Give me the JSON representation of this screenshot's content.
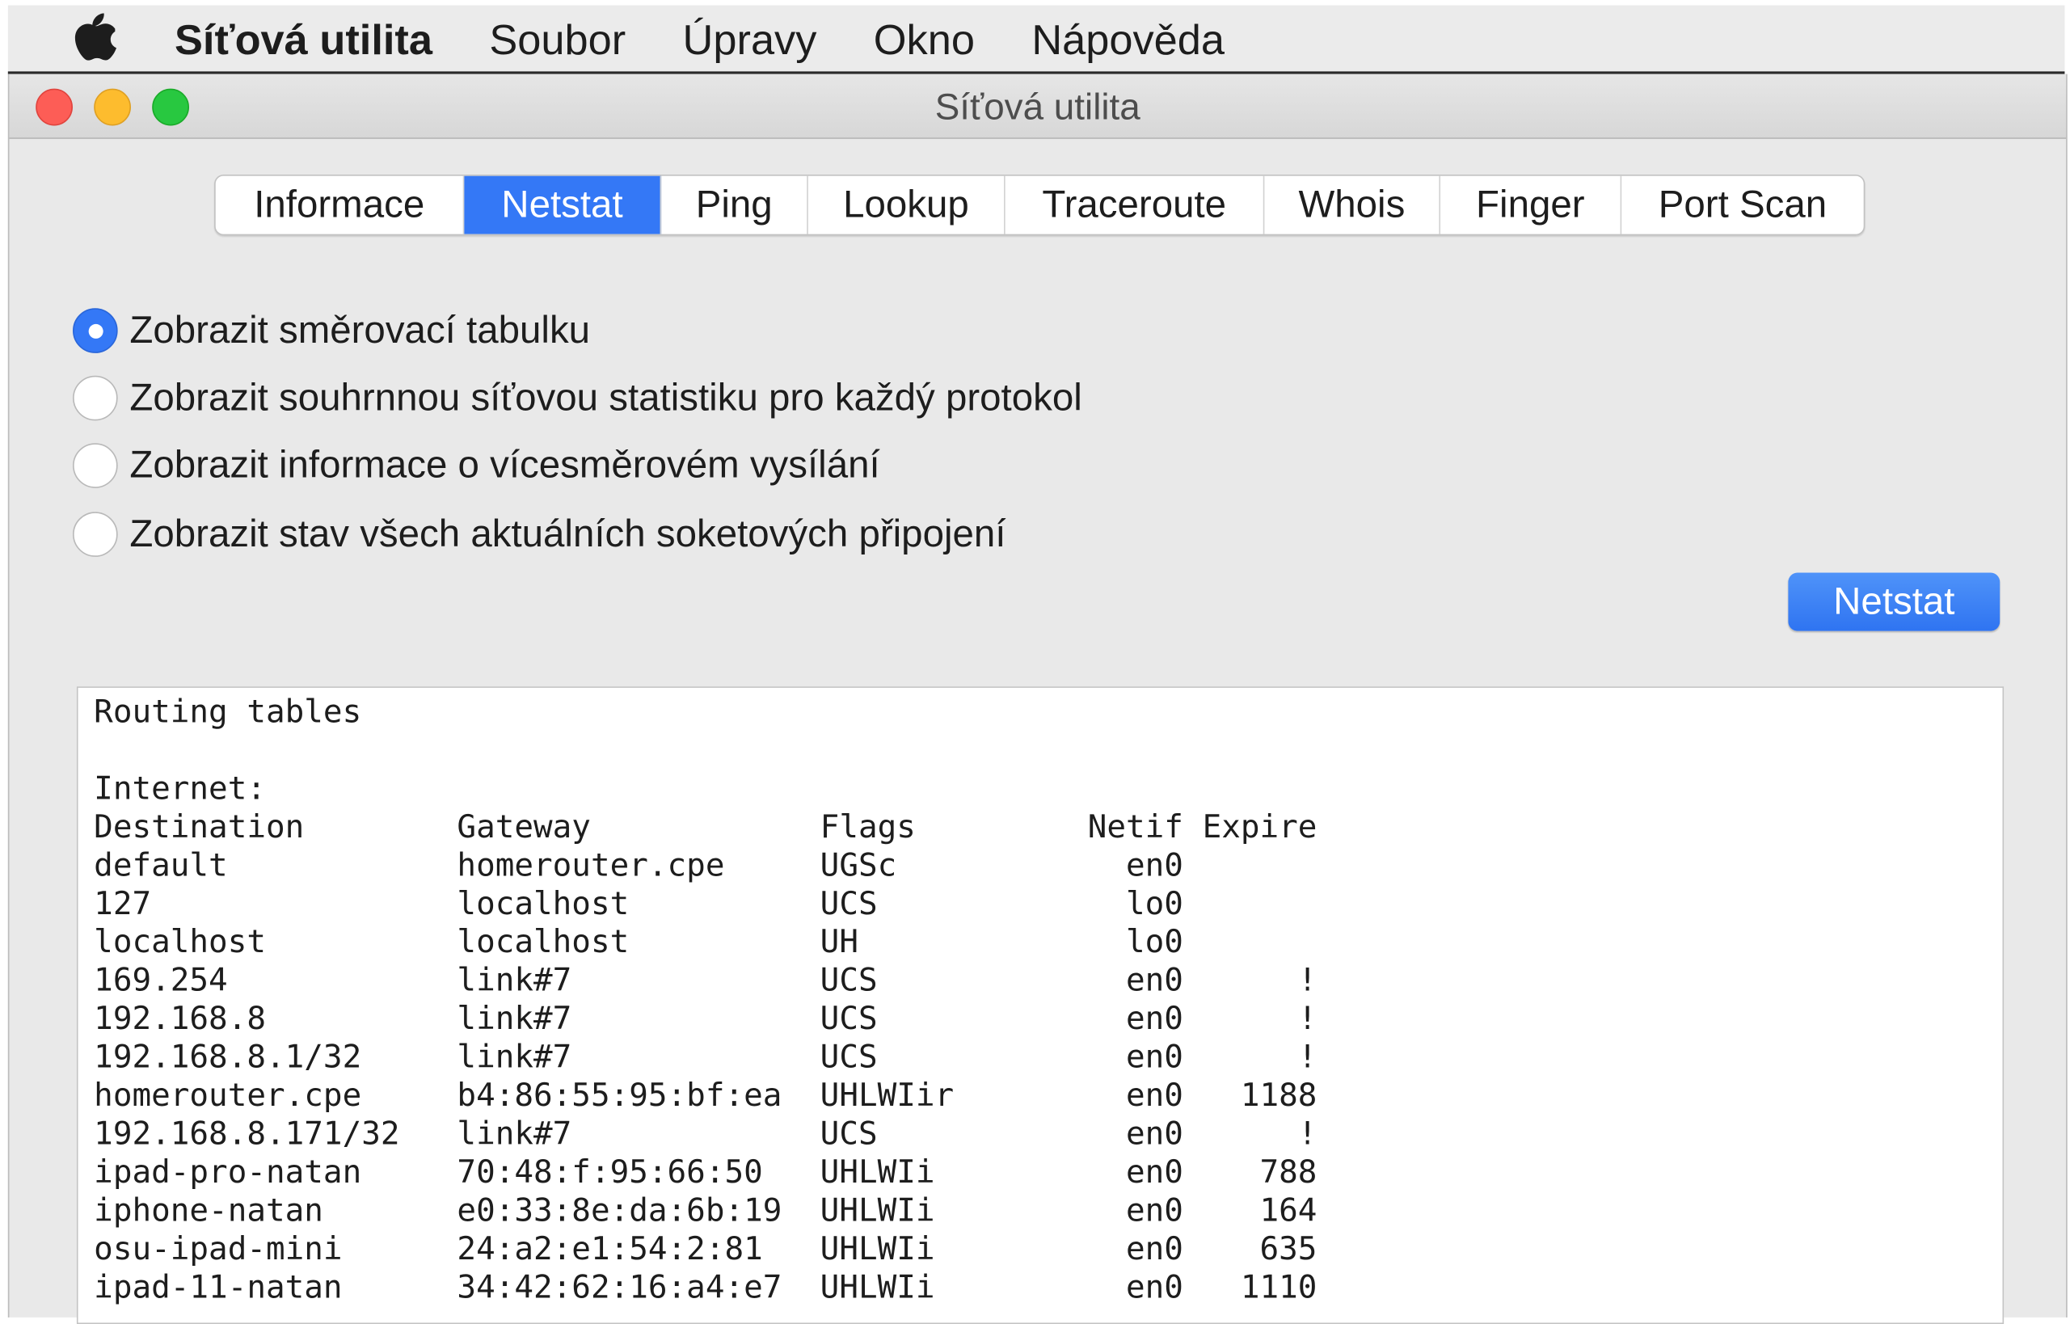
{
  "menubar": {
    "apple_icon": "apple-logo-icon",
    "app_name": "Síťová utilita",
    "items": [
      "Soubor",
      "Úpravy",
      "Okno",
      "Nápověda"
    ]
  },
  "window": {
    "title": "Síťová utilita"
  },
  "tabs": [
    {
      "label": "Informace",
      "active": false
    },
    {
      "label": "Netstat",
      "active": true
    },
    {
      "label": "Ping",
      "active": false
    },
    {
      "label": "Lookup",
      "active": false
    },
    {
      "label": "Traceroute",
      "active": false
    },
    {
      "label": "Whois",
      "active": false
    },
    {
      "label": "Finger",
      "active": false
    },
    {
      "label": "Port Scan",
      "active": false
    }
  ],
  "options": [
    {
      "label": "Zobrazit směrovací tabulku",
      "selected": true
    },
    {
      "label": "Zobrazit souhrnnou síťovou statistiku pro každý protokol",
      "selected": false
    },
    {
      "label": "Zobrazit informace o vícesměrovém vysílání",
      "selected": false
    },
    {
      "label": "Zobrazit stav všech aktuálních soketových připojení",
      "selected": false
    }
  ],
  "action_button": "Netstat",
  "output": {
    "lines": [
      "Routing tables",
      "",
      "Internet:",
      "Destination        Gateway            Flags         Netif Expire",
      "default            homerouter.cpe     UGSc            en0",
      "127                localhost          UCS             lo0",
      "localhost          localhost          UH              lo0",
      "169.254            link#7             UCS             en0      !",
      "192.168.8          link#7             UCS             en0      !",
      "192.168.8.1/32     link#7             UCS             en0      !",
      "homerouter.cpe     b4:86:55:95:bf:ea  UHLWIir         en0   1188",
      "192.168.8.171/32   link#7             UCS             en0      !",
      "ipad-pro-natan     70:48:f:95:66:50   UHLWIi          en0    788",
      "iphone-natan       e0:33:8e:da:6b:19  UHLWIi          en0    164",
      "osu-ipad-mini      24:a2:e1:54:2:81   UHLWIi          en0    635",
      "ipad-11-natan      34:42:62:16:a4:e7  UHLWIi          en0   1110"
    ]
  },
  "colors": {
    "accent": "#3478f6",
    "close": "#fd5d56",
    "minimize": "#fdbc2e",
    "maximize": "#28c840"
  }
}
